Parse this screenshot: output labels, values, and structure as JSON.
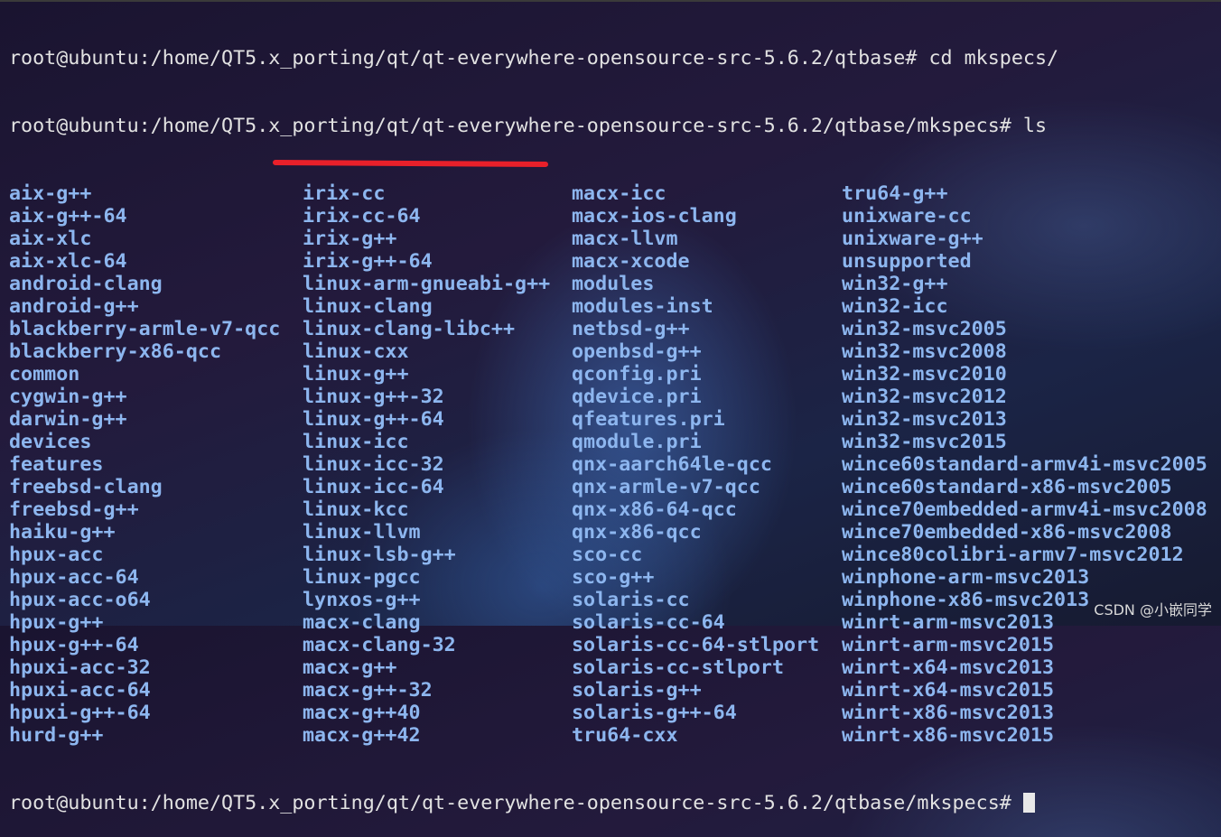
{
  "terminal": {
    "prompt1": "root@ubuntu:/home/QT5.x_porting/qt/qt-everywhere-opensource-src-5.6.2/qtbase# cd mkspecs/",
    "prompt2": "root@ubuntu:/home/QT5.x_porting/qt/qt-everywhere-opensource-src-5.6.2/qtbase/mkspecs# ls",
    "prompt3": "root@ubuntu:/home/QT5.x_porting/qt/qt-everywhere-opensource-src-5.6.2/qtbase/mkspecs# ",
    "highlighted_entry": "linux-arm-gnueabi-g++",
    "highlight_color": "#e8202a",
    "entry_color": "#8db6ef",
    "columns": [
      [
        "aix-g++",
        "aix-g++-64",
        "aix-xlc",
        "aix-xlc-64",
        "android-clang",
        "android-g++",
        "blackberry-armle-v7-qcc",
        "blackberry-x86-qcc",
        "common",
        "cygwin-g++",
        "darwin-g++",
        "devices",
        "features",
        "freebsd-clang",
        "freebsd-g++",
        "haiku-g++",
        "hpux-acc",
        "hpux-acc-64",
        "hpux-acc-o64",
        "hpux-g++",
        "hpux-g++-64",
        "hpuxi-acc-32",
        "hpuxi-acc-64",
        "hpuxi-g++-64",
        "hurd-g++"
      ],
      [
        "irix-cc",
        "irix-cc-64",
        "irix-g++",
        "irix-g++-64",
        "linux-arm-gnueabi-g++",
        "linux-clang",
        "linux-clang-libc++",
        "linux-cxx",
        "linux-g++",
        "linux-g++-32",
        "linux-g++-64",
        "linux-icc",
        "linux-icc-32",
        "linux-icc-64",
        "linux-kcc",
        "linux-llvm",
        "linux-lsb-g++",
        "linux-pgcc",
        "lynxos-g++",
        "macx-clang",
        "macx-clang-32",
        "macx-g++",
        "macx-g++-32",
        "macx-g++40",
        "macx-g++42"
      ],
      [
        "macx-icc",
        "macx-ios-clang",
        "macx-llvm",
        "macx-xcode",
        "modules",
        "modules-inst",
        "netbsd-g++",
        "openbsd-g++",
        "qconfig.pri",
        "qdevice.pri",
        "qfeatures.pri",
        "qmodule.pri",
        "qnx-aarch64le-qcc",
        "qnx-armle-v7-qcc",
        "qnx-x86-64-qcc",
        "qnx-x86-qcc",
        "sco-cc",
        "sco-g++",
        "solaris-cc",
        "solaris-cc-64",
        "solaris-cc-64-stlport",
        "solaris-cc-stlport",
        "solaris-g++",
        "solaris-g++-64",
        "tru64-cxx"
      ],
      [
        "tru64-g++",
        "unixware-cc",
        "unixware-g++",
        "unsupported",
        "win32-g++",
        "win32-icc",
        "win32-msvc2005",
        "win32-msvc2008",
        "win32-msvc2010",
        "win32-msvc2012",
        "win32-msvc2013",
        "win32-msvc2015",
        "wince60standard-armv4i-msvc2005",
        "wince60standard-x86-msvc2005",
        "wince70embedded-armv4i-msvc2008",
        "wince70embedded-x86-msvc2008",
        "wince80colibri-armv7-msvc2012",
        "winphone-arm-msvc2013",
        "winphone-x86-msvc2013",
        "winrt-arm-msvc2013",
        "winrt-arm-msvc2015",
        "winrt-x64-msvc2013",
        "winrt-x64-msvc2015",
        "winrt-x86-msvc2013",
        "winrt-x86-msvc2015"
      ]
    ]
  },
  "watermark": "CSDN @小嵌同学"
}
